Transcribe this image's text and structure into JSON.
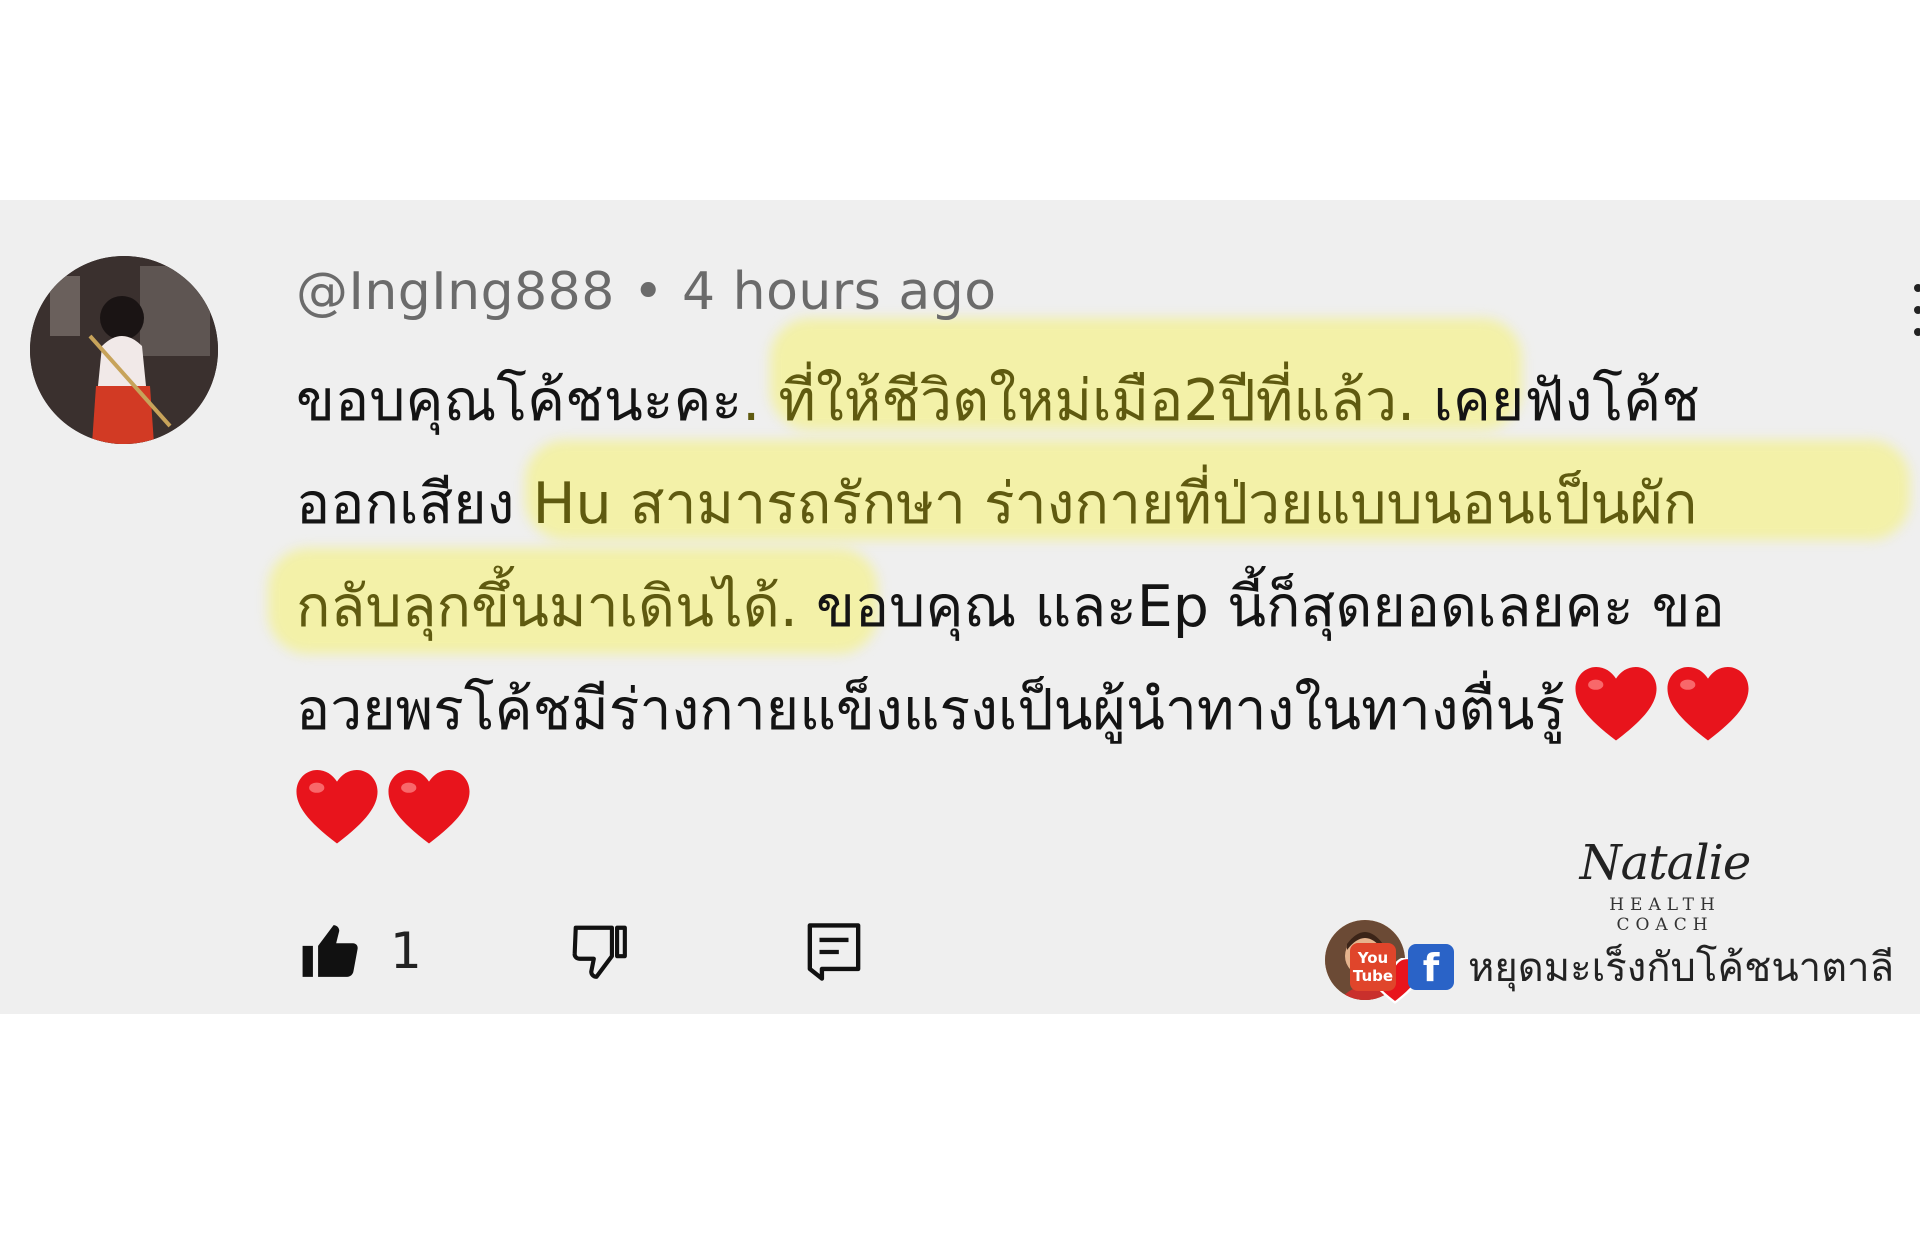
{
  "comment": {
    "author": "@IngIng888",
    "separator": "•",
    "time": "4 hours ago",
    "lines": [
      {
        "plain_a": "ขอบคุณโค้ชนะคะ",
        "mark": ". ที่ให้ชีวิตใหม่เมือ2ปีที่แล้ว.",
        "plain_b": " เคยฟังโค้ช"
      },
      {
        "plain_a": "ออกเสียง ",
        "mark": "Hu สามารถรักษา ร่างกายที่ป่วยแบบนอนเป็นผัก",
        "plain_b": ""
      },
      {
        "plain_a": "",
        "mark": "กลับลุกขึ้นมาเดินได้.",
        "plain_b": " ขอบคุณ และEp นี้ก็สุดยอดเลยคะ ขอ"
      },
      {
        "plain_a": "อวยพรโค้ชมีร่างกายแข็งแรงเป็นผู้นำทางในทางตื่นรู้",
        "mark": "",
        "plain_b": ""
      }
    ],
    "heart_emoji": "heart-icon"
  },
  "actions": {
    "like_count": "1",
    "like_icon": "thumbs-up-icon",
    "dislike_icon": "thumbs-down-icon",
    "reply_icon": "comment-icon"
  },
  "brand": {
    "script": "Natalie",
    "subtitle": "HEALTH  COACH"
  },
  "social": {
    "youtube_top": "You",
    "youtube_bottom": "Tube",
    "facebook": "f",
    "channel": "หยุดมะเร็งกับโค้ชนาตาลี"
  },
  "colors": {
    "highlight": "#f5f26e",
    "heart": "#e8141c",
    "panel": "#efefef"
  }
}
